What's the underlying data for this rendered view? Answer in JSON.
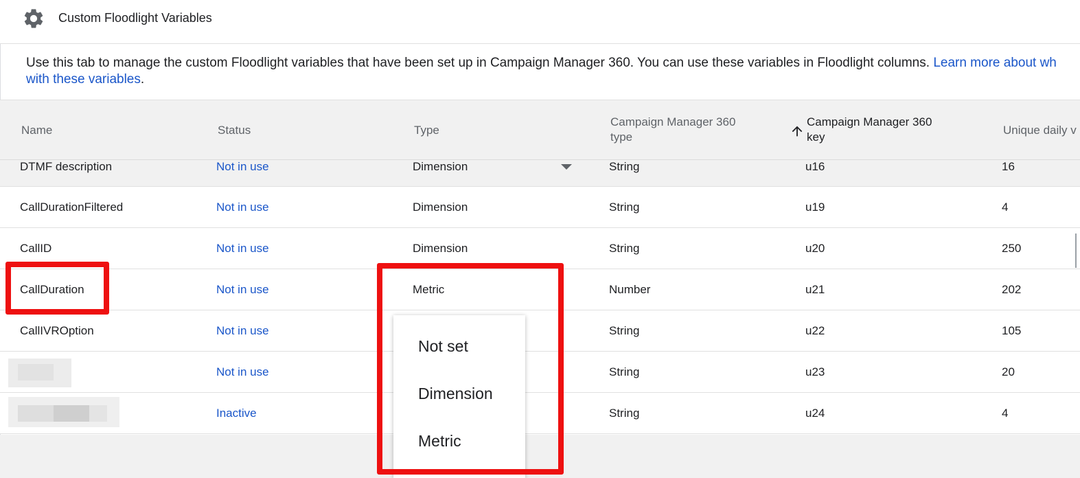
{
  "header": {
    "title": "Custom Floodlight Variables",
    "icon": "gear-icon"
  },
  "description": {
    "text": "Use this tab to manage the custom Floodlight variables that have been set up in Campaign Manager 360. You can use these variables in Floodlight columns. ",
    "link_part1": "Learn more about wh",
    "link_part2": "with these variables",
    "trailing": "."
  },
  "table": {
    "columns": {
      "name": "Name",
      "status": "Status",
      "type": "Type",
      "cm_type_line1": "Campaign Manager 360",
      "cm_type_line2": "type",
      "cm_key_line1": "Campaign Manager 360",
      "cm_key_line2": "key",
      "unique_daily": "Unique daily v"
    },
    "rows": [
      {
        "name": "DTMF description",
        "status": "Not in use",
        "type": "Dimension",
        "cm_type": "String",
        "key": "u16",
        "unique": "16"
      },
      {
        "name": "CallDurationFiltered",
        "status": "Not in use",
        "type": "Dimension",
        "cm_type": "String",
        "key": "u19",
        "unique": "4"
      },
      {
        "name": "CallID",
        "status": "Not in use",
        "type": "Dimension",
        "cm_type": "String",
        "key": "u20",
        "unique": "250"
      },
      {
        "name": "CallDuration",
        "status": "Not in use",
        "type": "Metric",
        "cm_type": "Number",
        "key": "u21",
        "unique": "202"
      },
      {
        "name": "CallIVROption",
        "status": "Not in use",
        "type": "",
        "cm_type": "String",
        "key": "u22",
        "unique": "105"
      },
      {
        "name": "",
        "status": "Not in use",
        "type": "",
        "cm_type": "String",
        "key": "u23",
        "unique": "20"
      },
      {
        "name": "",
        "status": "Inactive",
        "type": "",
        "cm_type": "String",
        "key": "u24",
        "unique": "4"
      }
    ]
  },
  "type_menu": {
    "options": [
      "Not set",
      "Dimension",
      "Metric"
    ]
  },
  "colors": {
    "link": "#1a56c9",
    "highlight": "#ee1010",
    "header_bg": "#f1f1f1"
  }
}
